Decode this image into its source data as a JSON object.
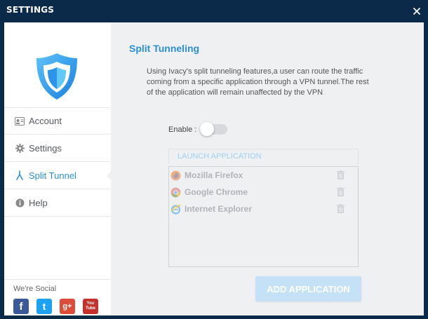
{
  "window": {
    "title": "SETTINGS",
    "close_icon": "close-icon"
  },
  "sidebar": {
    "items": [
      {
        "label": "Account",
        "icon": "account-card-icon",
        "active": false
      },
      {
        "label": "Settings",
        "icon": "gear-icon",
        "active": false
      },
      {
        "label": "Split Tunnel",
        "icon": "split-tunnel-icon",
        "active": true
      },
      {
        "label": "Help",
        "icon": "info-icon",
        "active": false
      }
    ],
    "social_label": "We're Social",
    "social": [
      {
        "name": "facebook",
        "glyph": "f",
        "color": "#3b5998"
      },
      {
        "name": "twitter",
        "glyph": "t",
        "color": "#1da1f2"
      },
      {
        "name": "google-plus",
        "glyph": "g+",
        "color": "#dd4b39"
      },
      {
        "name": "youtube",
        "glyph": "You Tube",
        "color": "#c4302b"
      }
    ]
  },
  "main": {
    "heading": "Split Tunneling",
    "description": "Using Ivacy's split tunneling features,a user can route the traffic coming from a specific application through a VPN tunnel.The rest of the application will remain unaffected by the VPN",
    "enable_label": "Enable :",
    "enable_on": false,
    "launch_header": "LAUNCH APPLICATION",
    "apps": [
      {
        "name": "Mozilla Firefox",
        "icon": "firefox-icon"
      },
      {
        "name": "Google Chrome",
        "icon": "chrome-icon"
      },
      {
        "name": "Internet Explorer",
        "icon": "ie-icon"
      }
    ],
    "add_button": "ADD APPLICATION"
  },
  "colors": {
    "titlebar": "#0b2a4a",
    "accent": "#2a8fd8",
    "content_bg": "#eef0f2",
    "button_disabled": "#c5e1f5"
  }
}
